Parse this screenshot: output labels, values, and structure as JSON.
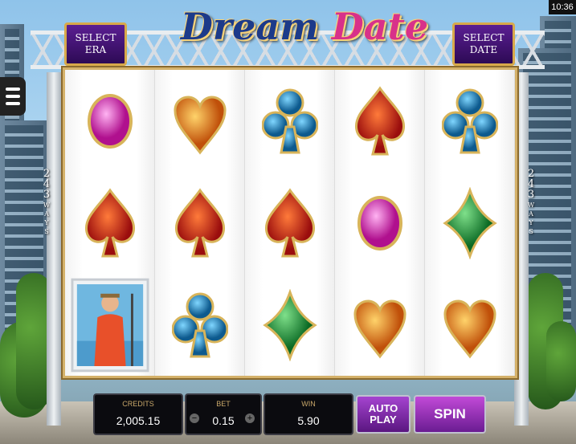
{
  "status": {
    "time": "10:36"
  },
  "game": {
    "title_part1": "Dream",
    "title_part2": "Date"
  },
  "buttons": {
    "select_era": [
      "SELECT",
      "ERA"
    ],
    "select_date": [
      "SELECT",
      "DATE"
    ],
    "auto_play": [
      "AUTO",
      "PLAY"
    ],
    "spin": "SPIN",
    "minus": "−",
    "plus": "+"
  },
  "ways": {
    "number_digits": [
      "2",
      "4",
      "3"
    ],
    "label_letters": [
      "W",
      "A",
      "Y",
      "S"
    ]
  },
  "meters": {
    "credits_label": "CREDITS",
    "credits_value": "2,005.15",
    "bet_label": "BET",
    "bet_value": "0.15",
    "win_label": "WIN",
    "win_value": "5.90"
  },
  "reels": [
    [
      "pink-gem",
      "red-spade",
      "character-card"
    ],
    [
      "orange-heart",
      "red-spade",
      "blue-club"
    ],
    [
      "blue-club",
      "red-spade",
      "green-diamond"
    ],
    [
      "red-spade",
      "pink-gem",
      "orange-heart"
    ],
    [
      "blue-club",
      "green-diamond",
      "orange-heart"
    ]
  ],
  "colors": {
    "spin": "#b036c8",
    "autoplay": "#8a2cb0",
    "frame_gold": "#d4b16a",
    "select_bg": "#4a1580"
  }
}
